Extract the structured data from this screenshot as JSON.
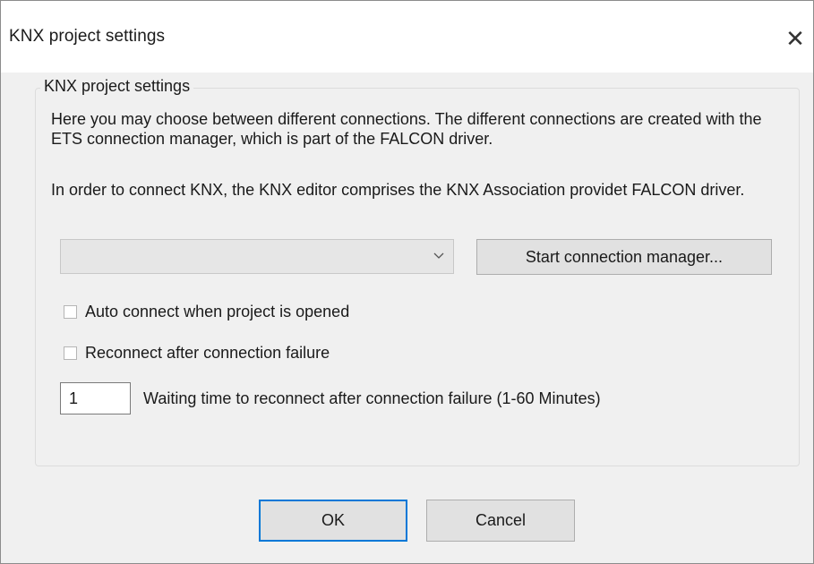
{
  "window": {
    "title": "KNX project settings",
    "close_glyph": "✕"
  },
  "group": {
    "legend": "KNX project settings",
    "paragraph1": "Here you may choose between different connections. The different connections are created with the ETS connection manager, which is part of the FALCON driver.",
    "paragraph2": "In order to connect KNX, the KNX editor comprises the KNX Association providet FALCON driver.",
    "connection_combo": {
      "value": "",
      "arrow_icon": "chevron-down-icon"
    },
    "start_connection_manager_label": "Start connection manager...",
    "auto_connect": {
      "label": "Auto connect when project is opened",
      "checked": false
    },
    "reconnect": {
      "label": "Reconnect after connection failure",
      "checked": false
    },
    "waiting_time": {
      "value": "1",
      "label": "Waiting time to reconnect after connection failure (1-60 Minutes)"
    }
  },
  "footer": {
    "ok_label": "OK",
    "cancel_label": "Cancel"
  },
  "colors": {
    "focus_border": "#0078d7",
    "dialog_background": "#f0f0f0"
  }
}
